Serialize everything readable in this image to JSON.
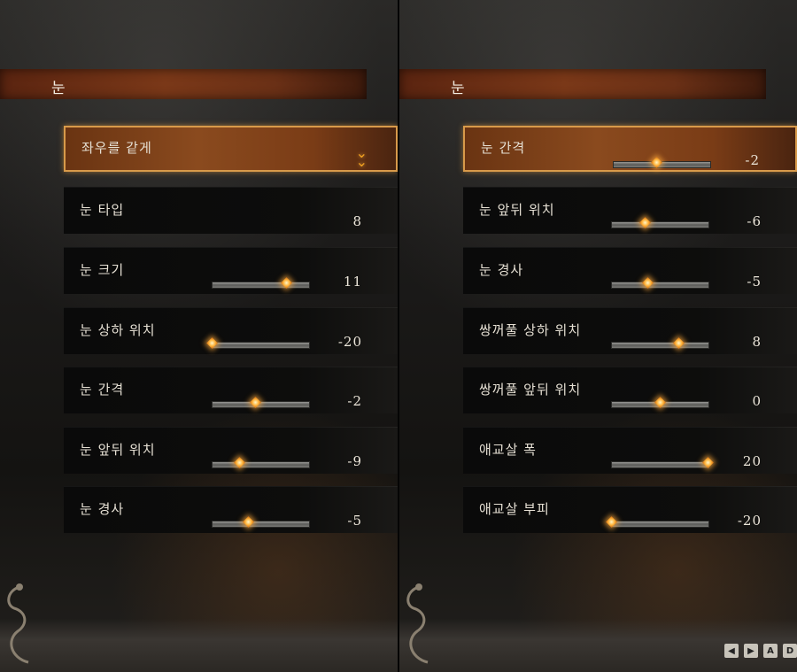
{
  "left_panel": {
    "header": "눈",
    "rows": [
      {
        "label": "좌우를 같게",
        "value": "",
        "type": "dropdown",
        "selected": true
      },
      {
        "label": "눈 타입",
        "value": "8",
        "type": "value"
      },
      {
        "label": "눈 크기",
        "value": "11",
        "type": "slider",
        "level": 0.77
      },
      {
        "label": "눈 상하 위치",
        "value": "-20",
        "type": "slider",
        "level": 0.0
      },
      {
        "label": "눈 간격",
        "value": "-2",
        "type": "slider",
        "level": 0.45
      },
      {
        "label": "눈 앞뒤 위치",
        "value": "-9",
        "type": "slider",
        "level": 0.28
      },
      {
        "label": "눈 경사",
        "value": "-5",
        "type": "slider",
        "level": 0.38
      }
    ]
  },
  "right_panel": {
    "header": "눈",
    "rows": [
      {
        "label": "눈 간격",
        "value": "-2",
        "type": "slider",
        "level": 0.45,
        "selected": true
      },
      {
        "label": "눈 앞뒤 위치",
        "value": "-6",
        "type": "slider",
        "level": 0.35
      },
      {
        "label": "눈 경사",
        "value": "-5",
        "type": "slider",
        "level": 0.38
      },
      {
        "label": "쌍꺼풀 상하 위치",
        "value": "8",
        "type": "slider",
        "level": 0.7
      },
      {
        "label": "쌍꺼풀 앞뒤 위치",
        "value": "0",
        "type": "slider",
        "level": 0.5
      },
      {
        "label": "애교살 폭",
        "value": "20",
        "type": "slider",
        "level": 1.0
      },
      {
        "label": "애교살 부피",
        "value": "-20",
        "type": "slider",
        "level": 0.0
      }
    ]
  },
  "key_hints": [
    "◀",
    "▶",
    "A",
    "D"
  ],
  "colors": {
    "accent": "#d89a4a",
    "header": "#7a3818",
    "knob": "#ffb33a"
  }
}
